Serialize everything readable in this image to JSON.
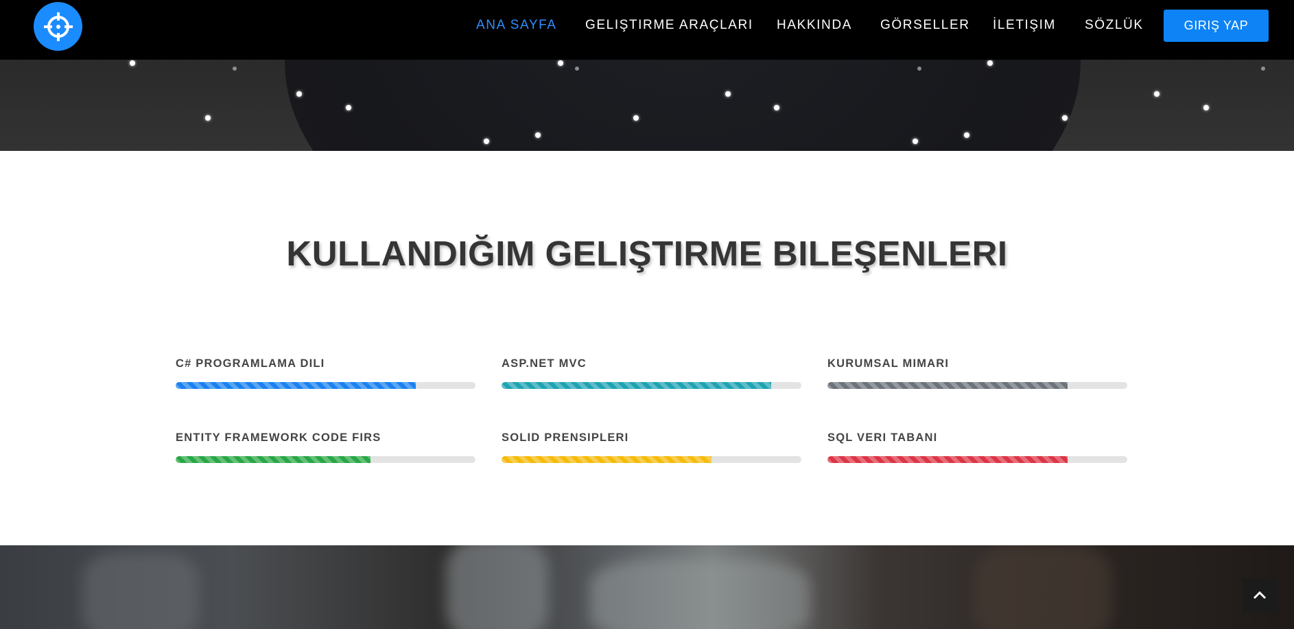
{
  "nav": {
    "logo_icon": "crosshair-icon",
    "links": [
      {
        "label": "ANA SAYFA",
        "active": true
      },
      {
        "label": "GELIŞTIRME ARAÇLARI",
        "active": false
      },
      {
        "label": "HAKKINDA",
        "active": false
      },
      {
        "label": "GÖRSELLER",
        "active": false
      },
      {
        "label": "İLETIŞIM",
        "active": false
      },
      {
        "label": "SÖZLÜK",
        "active": false
      }
    ],
    "login_label": "GIRIŞ YAP",
    "active_color": "#2f8fff",
    "button_color": "#0d83f5"
  },
  "skills_section": {
    "title": "KULLANDIĞIM GELIŞTIRME BILEŞENLERI",
    "items": [
      {
        "label": "C# PROGRAMLAMA DILI",
        "percent": 80,
        "color": "#1a82f0"
      },
      {
        "label": "ASP.NET MVC",
        "percent": 90,
        "color": "#1fa3b3"
      },
      {
        "label": "KURUMSAL MIMARI",
        "percent": 80,
        "color": "#6c737b"
      },
      {
        "label": "ENTITY FRAMEWORK CODE FIRS",
        "percent": 65,
        "color": "#28a745"
      },
      {
        "label": "SOLID PRENSIPLERI",
        "percent": 70,
        "color": "#f5bb0c"
      },
      {
        "label": "SQL VERI TABANI",
        "percent": 80,
        "color": "#dc3545"
      }
    ]
  },
  "back_to_top_icon": "chevron-up-icon"
}
